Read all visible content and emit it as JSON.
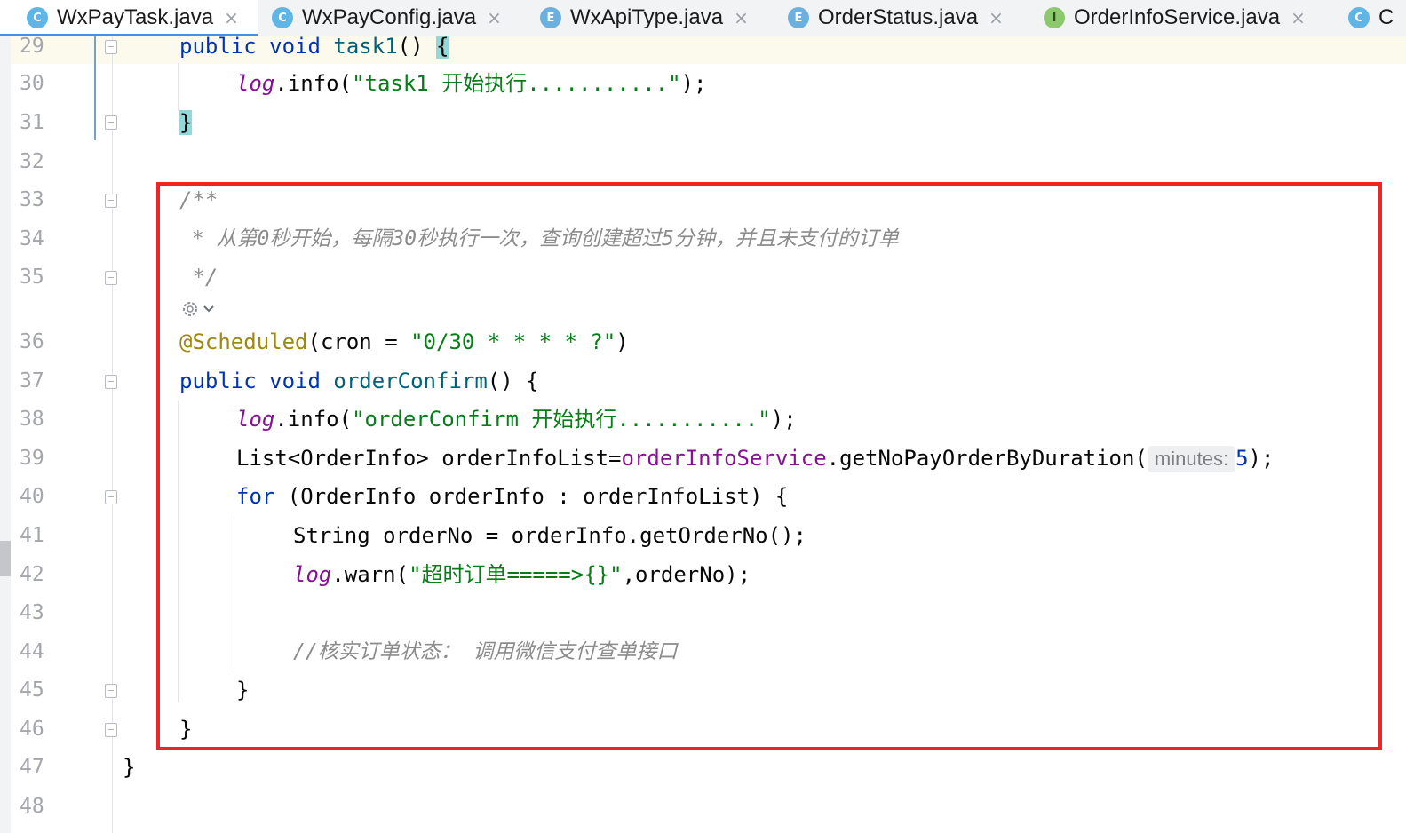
{
  "tabs": [
    {
      "icon": "C",
      "label": "WxPayTask.java",
      "active": true
    },
    {
      "icon": "C",
      "label": "WxPayConfig.java",
      "active": false
    },
    {
      "icon": "E",
      "label": "WxApiType.java",
      "active": false
    },
    {
      "icon": "E",
      "label": "OrderStatus.java",
      "active": false
    },
    {
      "icon": "I",
      "label": "OrderInfoService.java",
      "active": false
    },
    {
      "icon": "C",
      "label": "C",
      "active": false
    }
  ],
  "tab_close_glyph": "×",
  "line_numbers": [
    "29",
    "30",
    "31",
    "32",
    "33",
    "34",
    "35",
    "36",
    "37",
    "38",
    "39",
    "40",
    "41",
    "42",
    "43",
    "44",
    "45",
    "46",
    "47",
    "48"
  ],
  "code": {
    "l29": {
      "kw1": "public",
      "kw2": "void",
      "fn": "task1",
      "rest": "()",
      "brace": "{"
    },
    "l30": {
      "fld": "log",
      "m": ".info(",
      "s": "\"task1 开始执行...........\"",
      "end": ");"
    },
    "l31": {
      "brace": "}"
    },
    "l33": {
      "c": "/**"
    },
    "l34": {
      "c": " * 从第0秒开始，每隔30秒执行一次，查询创建超过5分钟，并且未支付的订单"
    },
    "l35": {
      "c": " */"
    },
    "l36": {
      "ann": "@Scheduled",
      "p1": "(cron = ",
      "s": "\"0/30 * * * * ?\"",
      "p2": ")"
    },
    "l37": {
      "kw1": "public",
      "kw2": "void",
      "fn": "orderConfirm",
      "rest": "() {"
    },
    "l38": {
      "fld": "log",
      "m": ".info(",
      "s": "\"orderConfirm 开始执行...........\"",
      "end": ");"
    },
    "l39": {
      "t1": "List<OrderInfo> orderInfoList=",
      "fld": "orderInfoService",
      "t2": ".getNoPayOrderByDuration(",
      "hint": "minutes:",
      "num": "5",
      "end": ");"
    },
    "l40": {
      "kw": "for",
      "rest": " (OrderInfo orderInfo : orderInfoList) {"
    },
    "l41": {
      "t": "String orderNo = orderInfo.getOrderNo();"
    },
    "l42": {
      "fld": "log",
      "m": ".warn(",
      "s": "\"超时订单=====>{}\"",
      "end": ",orderNo);"
    },
    "l44": {
      "c": "//核实订单状态： 调用微信支付查单接口"
    },
    "l45": {
      "brace": "}"
    },
    "l46": {
      "brace": "}"
    },
    "l47": {
      "brace": "}"
    }
  },
  "colors": {
    "keyword": "#0033b3",
    "string": "#067d17",
    "field": "#871094",
    "annotation": "#9e880d",
    "comment": "#8c8c8c",
    "highlight_box": "#ec2525"
  },
  "icons": {
    "generate": "ai-generate-icon",
    "chevron": "chevron-down-icon"
  }
}
